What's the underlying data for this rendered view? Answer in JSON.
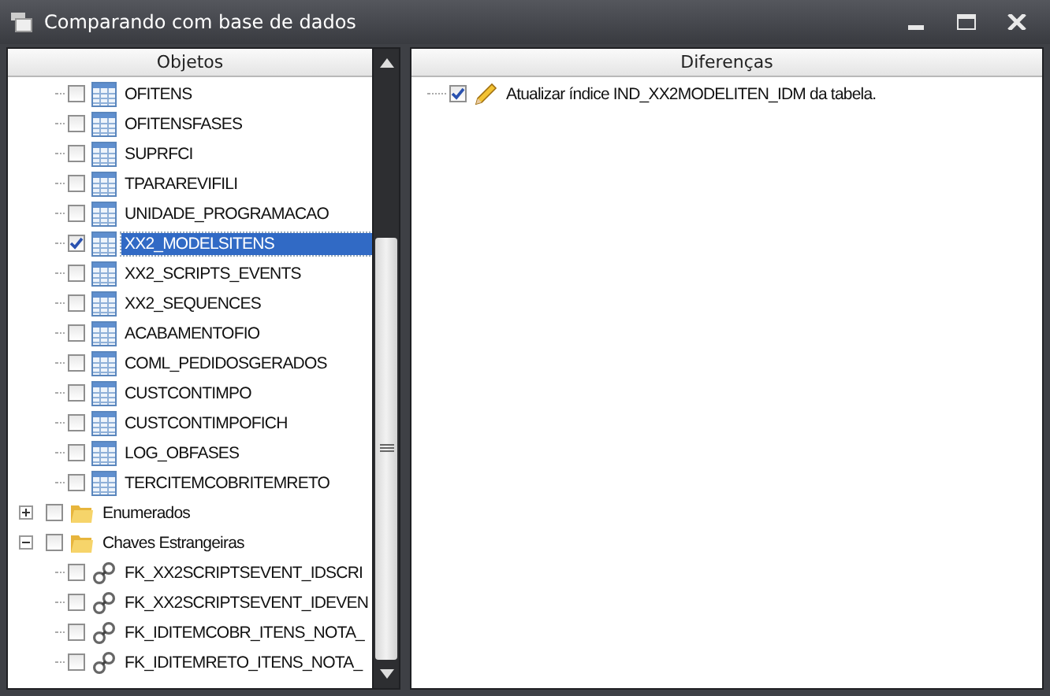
{
  "window": {
    "title": "Comparando com base de dados"
  },
  "objects_panel": {
    "header": "Objetos",
    "continued_children": [
      {
        "kind": "table",
        "label": "OFITENS",
        "checked": false,
        "selected": false
      },
      {
        "kind": "table",
        "label": "OFITENSFASES",
        "checked": false,
        "selected": false
      },
      {
        "kind": "table",
        "label": "SUPRFCI",
        "checked": false,
        "selected": false
      },
      {
        "kind": "table",
        "label": "TPARAREVIFILI",
        "checked": false,
        "selected": false
      },
      {
        "kind": "table",
        "label": "UNIDADE_PROGRAMACAO",
        "checked": false,
        "selected": false
      },
      {
        "kind": "table",
        "label": "XX2_MODELSITENS",
        "checked": true,
        "selected": true
      },
      {
        "kind": "table",
        "label": "XX2_SCRIPTS_EVENTS",
        "checked": false,
        "selected": false
      },
      {
        "kind": "table",
        "label": "XX2_SEQUENCES",
        "checked": false,
        "selected": false
      },
      {
        "kind": "table",
        "label": "ACABAMENTOFIO",
        "checked": false,
        "selected": false
      },
      {
        "kind": "table",
        "label": "COML_PEDIDOSGERADOS",
        "checked": false,
        "selected": false
      },
      {
        "kind": "table",
        "label": "CUSTCONTIMPO",
        "checked": false,
        "selected": false
      },
      {
        "kind": "table",
        "label": "CUSTCONTIMPOFICH",
        "checked": false,
        "selected": false
      },
      {
        "kind": "table",
        "label": "LOG_OBFASES",
        "checked": false,
        "selected": false
      },
      {
        "kind": "table",
        "label": "TERCITEMCOBRITEMRETO",
        "checked": false,
        "selected": false
      }
    ],
    "nodes": [
      {
        "kind": "folder",
        "label": "Enumerados",
        "checked": false,
        "selected": false,
        "expanded": false
      },
      {
        "kind": "folder",
        "label": "Chaves Estrangeiras",
        "checked": false,
        "selected": false,
        "expanded": true,
        "children": [
          {
            "kind": "key",
            "label": "FK_XX2SCRIPTSEVENT_IDSCRI",
            "checked": false,
            "selected": false
          },
          {
            "kind": "key",
            "label": "FK_XX2SCRIPTSEVENT_IDEVEN",
            "checked": false,
            "selected": false
          },
          {
            "kind": "key",
            "label": "FK_IDITEMCOBR_ITENS_NOTA_",
            "checked": false,
            "selected": false
          },
          {
            "kind": "key",
            "label": "FK_IDITEMRETO_ITENS_NOTA_",
            "checked": false,
            "selected": false
          }
        ]
      }
    ]
  },
  "differences_panel": {
    "header": "Diferenças",
    "items": [
      {
        "kind": "edit",
        "label": "Atualizar índice IND_XX2MODELITEN_IDM da tabela.",
        "checked": true
      }
    ]
  }
}
